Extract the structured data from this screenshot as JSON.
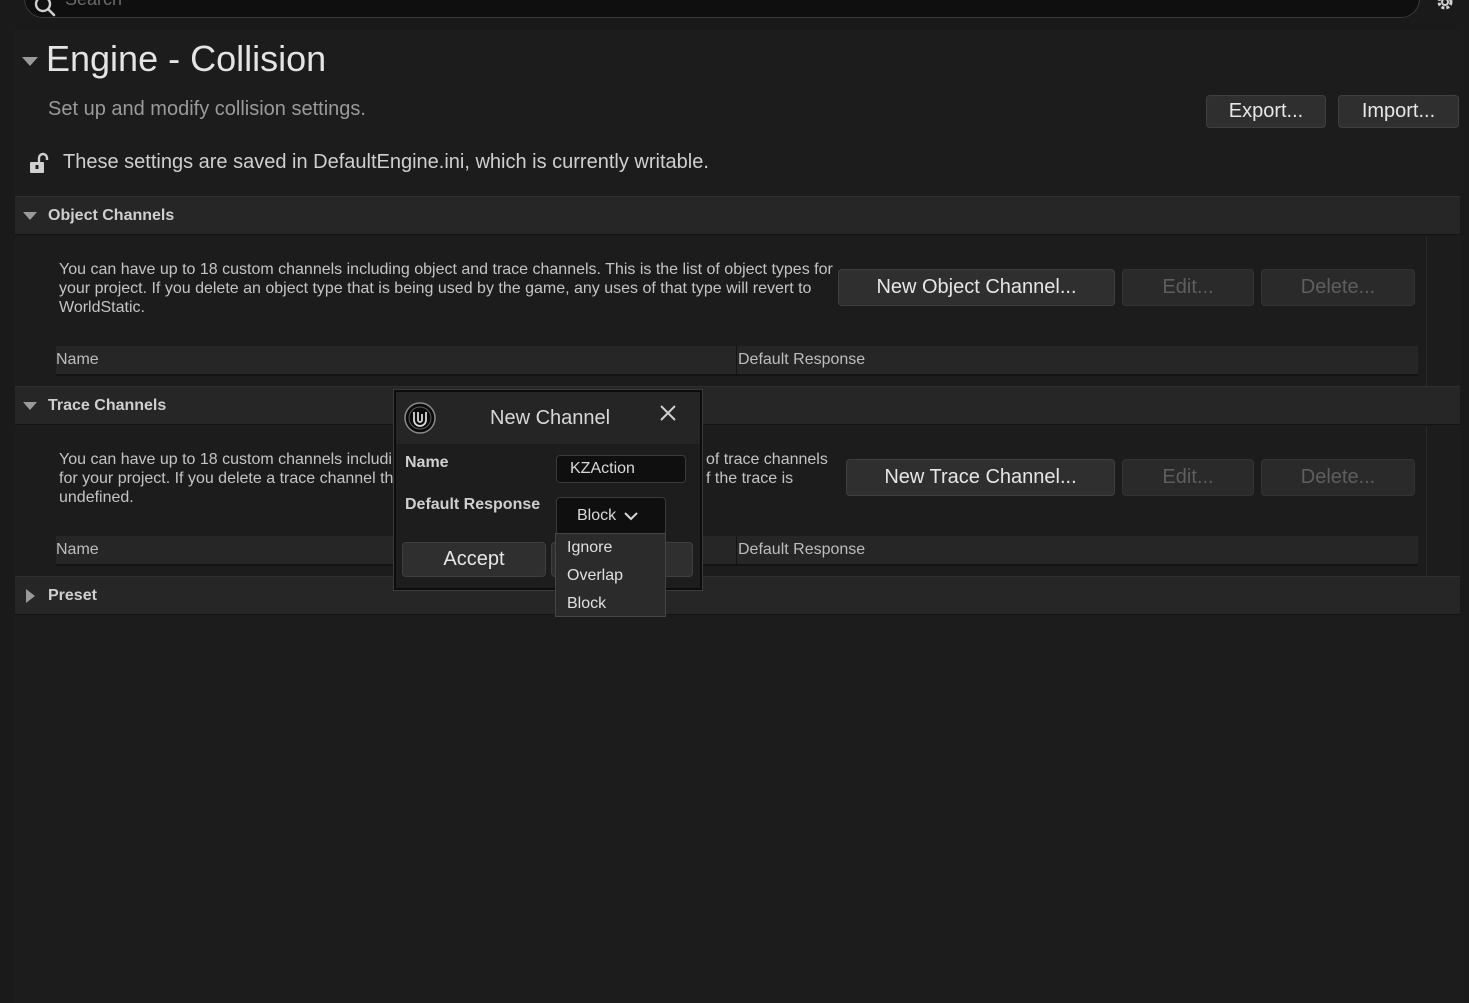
{
  "search": {
    "placeholder": "Search"
  },
  "page": {
    "title": "Engine - Collision",
    "subtitle": "Set up and modify collision settings.",
    "export_label": "Export...",
    "import_label": "Import...",
    "writable_notice": "These settings are saved in DefaultEngine.ini, which is currently writable."
  },
  "object_channels": {
    "header": "Object Channels",
    "description": "You can have up to 18 custom channels including object and trace channels. This is the list of object types for your project. If you delete an object type that is being used by the game, any uses of that type will revert to WorldStatic.",
    "new_label": "New Object Channel...",
    "edit_label": "Edit...",
    "delete_label": "Delete...",
    "columns": [
      "Name",
      "Default Response"
    ]
  },
  "trace_channels": {
    "header": "Trace Channels",
    "description_left": "You can have up to 18 custom channels includi\nfor your project. If you delete a trace channel th\nundefined.",
    "description_right": "of trace channels\nf the trace is",
    "new_label": "New Trace Channel...",
    "edit_label": "Edit...",
    "delete_label": "Delete...",
    "columns": [
      "Name",
      "Default Response"
    ]
  },
  "preset": {
    "header": "Preset"
  },
  "modal": {
    "title": "New Channel",
    "name_label": "Name",
    "name_value": "KZAction",
    "response_label": "Default Response",
    "response_value": "Block",
    "accept_label": "Accept",
    "options": [
      "Ignore",
      "Overlap",
      "Block"
    ]
  },
  "colors": {
    "background": "#1a1a1a",
    "panel": "#1c1c1c",
    "header": "#262626",
    "button": "#2f2f2f"
  }
}
